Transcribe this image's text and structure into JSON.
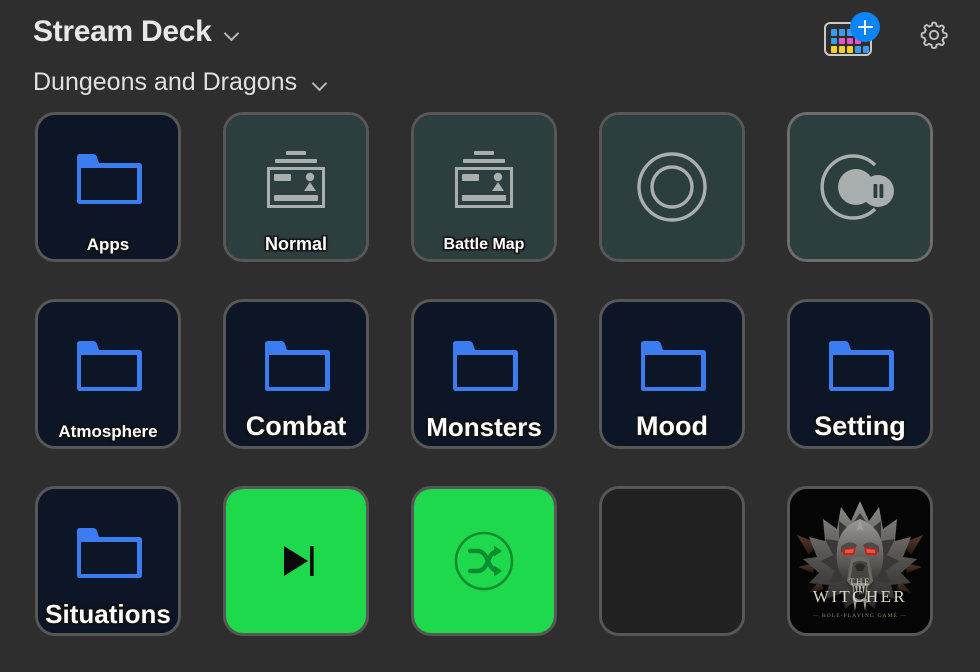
{
  "header": {
    "app_title": "Stream Deck",
    "app_title_chevron": "chevron-down-icon",
    "profile_name": "Dungeons and Dragons",
    "profile_chevron": "chevron-down-icon",
    "add_device_icon": "stream-deck-add-icon",
    "add_badge": "plus-icon",
    "settings_icon": "gear-icon",
    "deck_dot_colors": [
      "#3b9bf0",
      "#3b9bf0",
      "#3b9bf0",
      "#e855c8",
      "#2e2e2e",
      "#3b9bf0",
      "#e855c8",
      "#e855c8",
      "#e855c8",
      "#2e2e2e",
      "#f2d024",
      "#f2d024",
      "#f2d024",
      "#3b9bf0",
      "#3b9bf0"
    ]
  },
  "colors": {
    "page_background": "#2e2e2e",
    "key_border": "#575757",
    "key_border_hover": "#6d6d6d",
    "folder_navy": "#0c1626",
    "folder_blue": "#3b7df0",
    "teal": "#2c3f3e",
    "teal_icon": "#a9aeae",
    "green": "#1ed94b",
    "green_icon": "#0a8c30",
    "empty_key": "#212121",
    "label_white": "#ffffff",
    "witcher_black": "#050505",
    "witcher_eye": "#c0231c"
  },
  "keys": [
    {
      "index": 1,
      "label": "Apps",
      "label_size": "17",
      "icon": "folder-icon",
      "style": "folder",
      "hover": false
    },
    {
      "index": 2,
      "label": "Normal",
      "label_size": "18",
      "icon": "window-card-icon",
      "style": "teal",
      "hover": false
    },
    {
      "index": 3,
      "label": "Battle Map",
      "label_size": "16",
      "icon": "window-card-icon",
      "style": "teal",
      "hover": false
    },
    {
      "index": 4,
      "label": "",
      "label_size": "18",
      "icon": "record-icon",
      "style": "teal",
      "hover": false
    },
    {
      "index": 5,
      "label": "",
      "label_size": "18",
      "icon": "record-pause-icon",
      "style": "teal",
      "hover": true
    },
    {
      "index": 6,
      "label": "Atmosphere",
      "label_size": "17",
      "icon": "folder-icon",
      "style": "folder",
      "hover": false
    },
    {
      "index": 7,
      "label": "Combat",
      "label_size": "27",
      "icon": "folder-icon",
      "style": "folder",
      "hover": false
    },
    {
      "index": 8,
      "label": "Monsters",
      "label_size": "26",
      "icon": "folder-icon",
      "style": "folder",
      "hover": false
    },
    {
      "index": 9,
      "label": "Mood",
      "label_size": "27",
      "icon": "folder-icon",
      "style": "folder",
      "hover": false
    },
    {
      "index": 10,
      "label": "Setting",
      "label_size": "27",
      "icon": "folder-icon",
      "style": "folder",
      "hover": false
    },
    {
      "index": 11,
      "label": "Situations",
      "label_size": "26",
      "icon": "folder-icon",
      "style": "folder",
      "hover": false
    },
    {
      "index": 12,
      "label": "",
      "label_size": "18",
      "icon": "next-track-icon",
      "style": "green",
      "hover": false
    },
    {
      "index": 13,
      "label": "",
      "label_size": "18",
      "icon": "shuffle-icon",
      "style": "green",
      "hover": false
    },
    {
      "index": 14,
      "label": "",
      "label_size": "18",
      "icon": "empty-key",
      "style": "empty",
      "hover": false
    },
    {
      "index": 15,
      "label": "",
      "label_size": "18",
      "icon": "the-witcher-icon",
      "style": "witcher",
      "hover": false
    }
  ],
  "witcher": {
    "word_small": "THE",
    "word_big": "WITCHER",
    "subtitle": "— ROLE-PLAYING GAME —"
  }
}
